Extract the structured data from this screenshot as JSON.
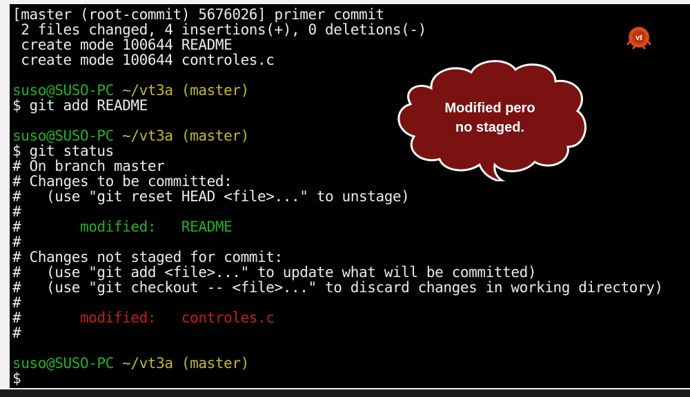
{
  "terminal": {
    "lines": [
      {
        "id": "l1",
        "segments": [
          {
            "text": "[master (root-commit) 5676026] primer commit",
            "color": "white"
          }
        ]
      },
      {
        "id": "l2",
        "segments": [
          {
            "text": " 2 files changed, 4 insertions(+), 0 deletions(-)",
            "color": "white"
          }
        ]
      },
      {
        "id": "l3",
        "segments": [
          {
            "text": " create mode 100644 README",
            "color": "white"
          }
        ]
      },
      {
        "id": "l4",
        "segments": [
          {
            "text": " create mode 100644 controles.c",
            "color": "white"
          }
        ]
      },
      {
        "id": "l5",
        "segments": [
          {
            "text": "",
            "color": "white"
          }
        ]
      },
      {
        "id": "l6",
        "segments": [
          {
            "text": "suso@SUSO-PC ",
            "color": "green"
          },
          {
            "text": "~/vt3a (master)",
            "color": "yellow"
          }
        ]
      },
      {
        "id": "l7",
        "segments": [
          {
            "text": "$ git add README",
            "color": "white"
          }
        ]
      },
      {
        "id": "l8",
        "segments": [
          {
            "text": "",
            "color": "white"
          }
        ]
      },
      {
        "id": "l9",
        "segments": [
          {
            "text": "suso@SUSO-PC ",
            "color": "green"
          },
          {
            "text": "~/vt3a (master)",
            "color": "yellow"
          }
        ]
      },
      {
        "id": "l10",
        "segments": [
          {
            "text": "$ git status",
            "color": "white"
          }
        ]
      },
      {
        "id": "l11",
        "segments": [
          {
            "text": "# On branch master",
            "color": "white"
          }
        ]
      },
      {
        "id": "l12",
        "segments": [
          {
            "text": "# Changes to be committed:",
            "color": "white"
          }
        ]
      },
      {
        "id": "l13",
        "segments": [
          {
            "text": "#   (use \"git reset HEAD <file>...\" to unstage)",
            "color": "white"
          }
        ]
      },
      {
        "id": "l14",
        "segments": [
          {
            "text": "#",
            "color": "white"
          }
        ]
      },
      {
        "id": "l15",
        "segments": [
          {
            "text": "#       ",
            "color": "white"
          },
          {
            "text": "modified:   README",
            "color": "green"
          }
        ]
      },
      {
        "id": "l16",
        "segments": [
          {
            "text": "#",
            "color": "white"
          }
        ]
      },
      {
        "id": "l17",
        "segments": [
          {
            "text": "# Changes not staged for commit:",
            "color": "white"
          }
        ]
      },
      {
        "id": "l18",
        "segments": [
          {
            "text": "#   (use \"git add <file>...\" to update what will be committed)",
            "color": "white"
          }
        ]
      },
      {
        "id": "l19",
        "segments": [
          {
            "text": "#   (use \"git checkout -- <file>...\" to discard changes in working directory)",
            "color": "white"
          }
        ]
      },
      {
        "id": "l20",
        "segments": [
          {
            "text": "#",
            "color": "white"
          }
        ]
      },
      {
        "id": "l21",
        "segments": [
          {
            "text": "#       ",
            "color": "white"
          },
          {
            "text": "modified:   controles.c",
            "color": "red"
          }
        ]
      },
      {
        "id": "l22",
        "segments": [
          {
            "text": "#",
            "color": "white"
          }
        ]
      },
      {
        "id": "l23",
        "segments": [
          {
            "text": "",
            "color": "white"
          }
        ]
      },
      {
        "id": "l24",
        "segments": [
          {
            "text": "suso@SUSO-PC ",
            "color": "green"
          },
          {
            "text": "~/vt3a (master)",
            "color": "yellow"
          }
        ]
      },
      {
        "id": "l25",
        "segments": [
          {
            "text": "$",
            "color": "white"
          }
        ]
      }
    ]
  },
  "callout": {
    "line1": "Modified pero",
    "line2": "no staged.",
    "fill": "#7a1212",
    "stroke": "#ffffff"
  },
  "logo": {
    "icon": "vt-logo-icon",
    "text": "vt",
    "color": "#d84a1b"
  },
  "colors": {
    "green": "#1fb31f",
    "yellow": "#c0bb2b",
    "red": "#c41d1d",
    "white": "#ececec"
  }
}
